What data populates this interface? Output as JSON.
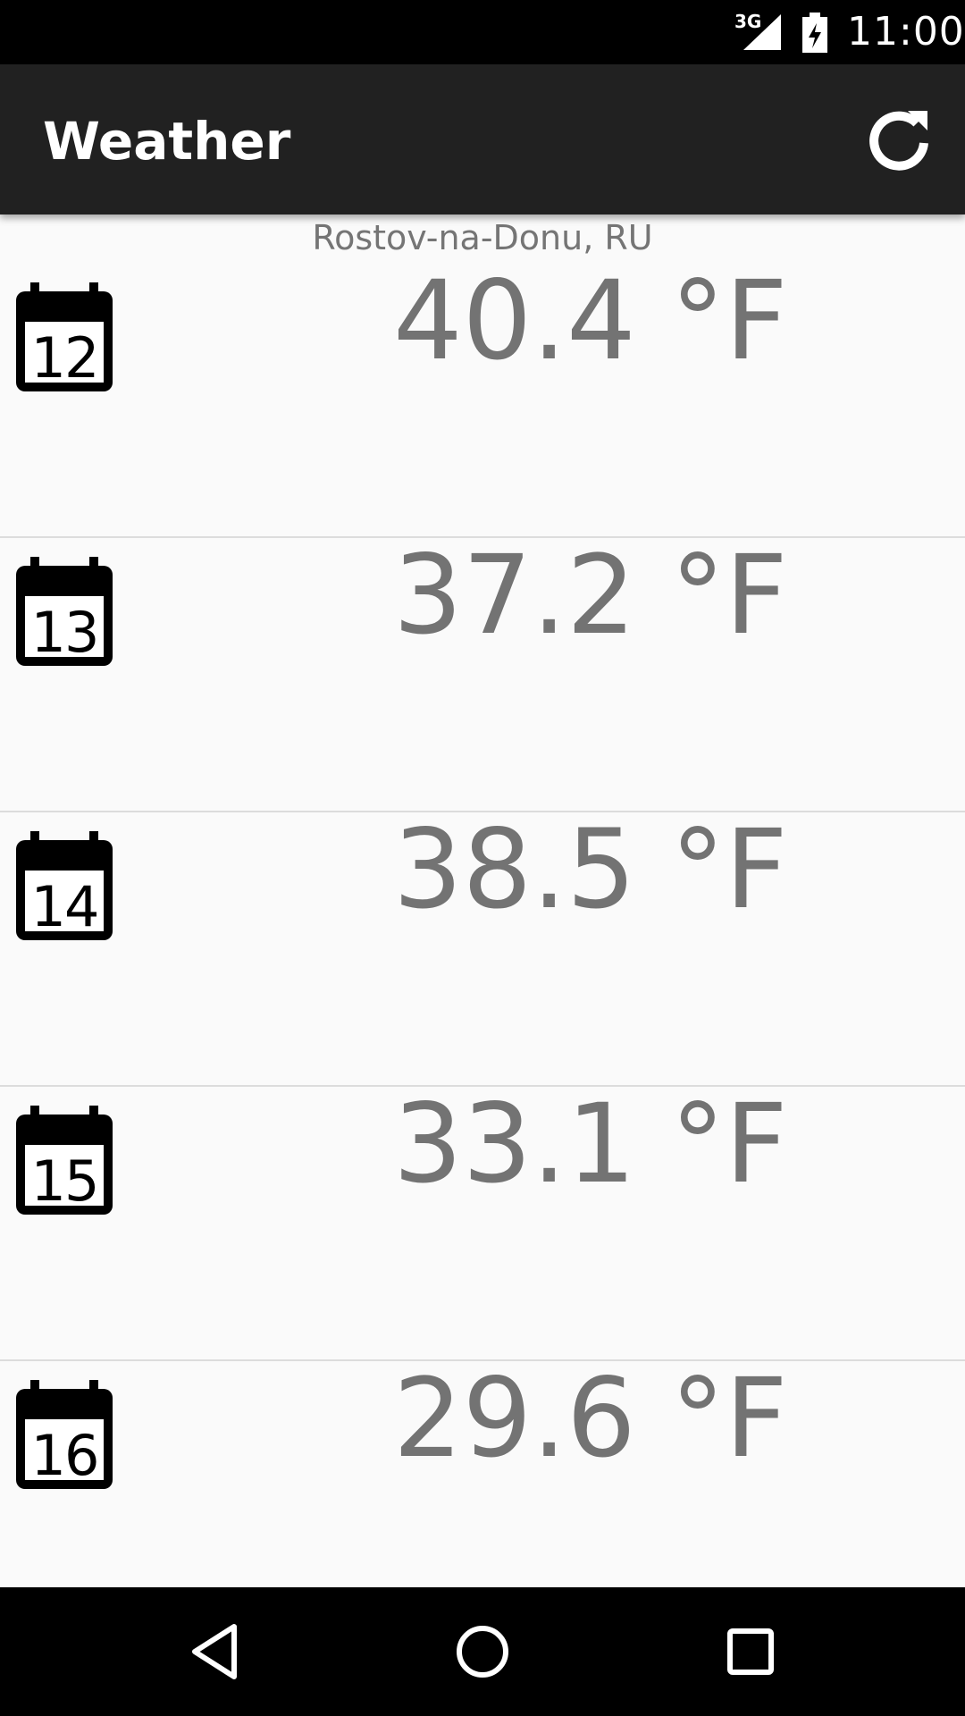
{
  "status_bar": {
    "network": "3G",
    "time": "11:00",
    "icons": [
      "signal-icon",
      "battery-charging-icon"
    ]
  },
  "app_bar": {
    "title": "Weather",
    "refresh_icon": "refresh-icon"
  },
  "location": "Rostov-na-Donu, RU",
  "forecast": [
    {
      "day": "12",
      "temp": "40.4 °F"
    },
    {
      "day": "13",
      "temp": "37.2 °F"
    },
    {
      "day": "14",
      "temp": "38.5 °F"
    },
    {
      "day": "15",
      "temp": "33.1 °F"
    },
    {
      "day": "16",
      "temp": "29.6 °F"
    }
  ],
  "nav_bar": {
    "icons": [
      "back-icon",
      "home-icon",
      "recents-icon"
    ]
  },
  "colors": {
    "app_bar": "#212121",
    "background": "#fafafa",
    "temp_text": "#737373",
    "divider": "#dcdcdc"
  }
}
